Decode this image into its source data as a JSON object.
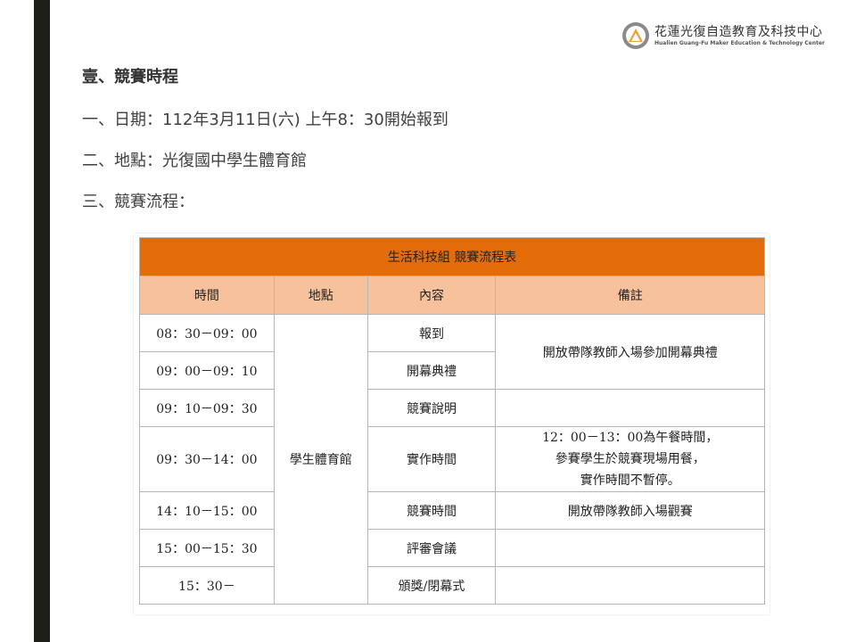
{
  "logo": {
    "name_cn": "花蓮光復自造教育及科技中心",
    "name_en": "Hualien Guang-Fu Maker Education & Technology Center"
  },
  "section": {
    "heading": "壹、競賽時程",
    "items": [
      "一、日期：112年3月11日(六)  上午8：30開始報到",
      "二、地點：光復國中學生體育館",
      "三、競賽流程："
    ]
  },
  "table": {
    "title": "生活科技組  競賽流程表",
    "headers": [
      "時間",
      "地點",
      "內容",
      "備註"
    ],
    "location": "學生體育館",
    "rows": [
      {
        "time": "08：30－09：00",
        "content": "報到"
      },
      {
        "time": "09：00－09：10",
        "content": "開幕典禮"
      },
      {
        "time": "09：10－09：30",
        "content": "競賽說明"
      },
      {
        "time": "09：30－14：00",
        "content": "實作時間"
      },
      {
        "time": "14：10－15：00",
        "content": "競賽時間"
      },
      {
        "time": "15：00－15：30",
        "content": "評審會議"
      },
      {
        "time": "15：30－",
        "content": "頒獎/閉幕式"
      }
    ],
    "notes": {
      "opening": "開放帶隊教師入場參加開幕典禮",
      "work_lines": [
        "12：00－13：00為午餐時間，",
        "參賽學生於競賽現場用餐，",
        "實作時間不暫停。"
      ],
      "competition": "開放帶隊教師入場觀賽"
    }
  },
  "colors": {
    "title_bg": "#e36c0a",
    "header_bg": "#f7c19c",
    "left_bar": "#1f1f1a"
  }
}
